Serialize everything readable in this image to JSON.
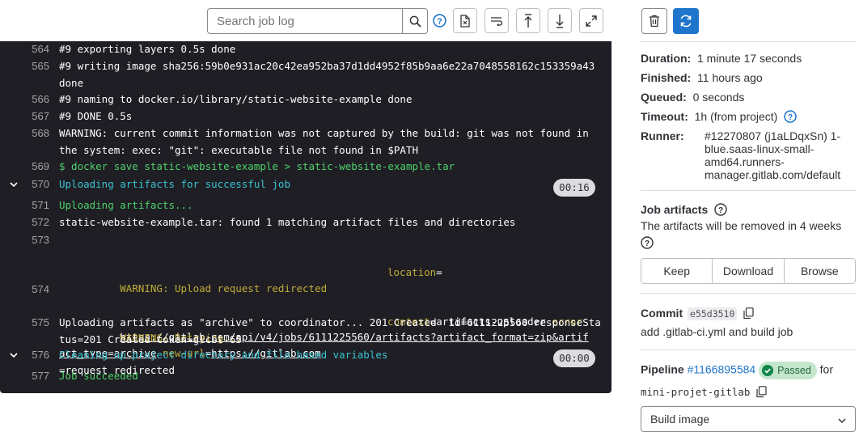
{
  "toolbar": {
    "search_placeholder": "Search job log",
    "icons": [
      "search-icon",
      "question-icon",
      "raw-file-icon",
      "wrap-text-icon",
      "scroll-top-icon",
      "scroll-bottom-icon",
      "fullscreen-icon"
    ]
  },
  "log": {
    "lines": [
      {
        "num": "564",
        "text": "#9 exporting layers 0.5s done"
      },
      {
        "num": "565",
        "text": "#9 writing image sha256:59b0e931ac20c42ea952ba37d1dd4952f85b9aa6e22a7048558162c153359a43 done"
      },
      {
        "num": "566",
        "text": "#9 naming to docker.io/library/static-website-example done"
      },
      {
        "num": "567",
        "text": "#9 DONE 0.5s"
      },
      {
        "num": "568",
        "text": "WARNING: current commit information was not captured by the build: git was not found in the system: exec: \"git\": executable file not found in $PATH"
      },
      {
        "num": "569",
        "text": "$ docker save static-website-example > static-website-example.tar"
      },
      {
        "num": "570",
        "text": "Uploading artifacts for successful job",
        "duration": "00:16"
      },
      {
        "num": "571",
        "text": "Uploading artifacts..."
      },
      {
        "num": "572",
        "text": "static-website-example.tar: found 1 matching artifact files and directories"
      },
      {
        "num": "573",
        "warn": "WARNING: Upload request redirected",
        "loc_key": "location",
        "loc_url": "https://gitlab.com/api/v4/jobs/6111225560/artifacts?artifact_format=zip&artifact_type=archive",
        "new_key": "new-url",
        "new_url": "https://gitlab.com"
      },
      {
        "num": "574",
        "warn": "WARNING: Retrying...",
        "ctx_key": "context",
        "ctx_val": "=artifacts-uploader",
        "err_key": "error",
        "err_val": "=request redirected"
      },
      {
        "num": "575",
        "text": "Uploading artifacts as \"archive\" to coordinator... 201 Created  id=6111225560 responseStatus=201 Created token=glcbt-65"
      },
      {
        "num": "576",
        "text": "Cleaning up project directory and file based variables",
        "duration": "00:00"
      },
      {
        "num": "577",
        "text": "Job succeeded"
      }
    ]
  },
  "sidebar": {
    "duration_label": "Duration:",
    "duration_value": "1 minute 17 seconds",
    "finished_label": "Finished:",
    "finished_value": "11 hours ago",
    "queued_label": "Queued:",
    "queued_value": "0 seconds",
    "timeout_label": "Timeout:",
    "timeout_value": "1h (from project)",
    "runner_label": "Runner:",
    "runner_value": "#12270807 (j1aLDqxSn) 1-blue.saas-linux-small-amd64.runners-manager.gitlab.com/default",
    "artifacts_title": "Job artifacts",
    "artifacts_text": "The artifacts will be removed in 4 weeks",
    "keep_label": "Keep",
    "download_label": "Download",
    "browse_label": "Browse",
    "commit_label": "Commit",
    "commit_sha": "e55d3510",
    "commit_message": "add .gitlab-ci.yml and build job",
    "pipeline_label": "Pipeline",
    "pipeline_id": "#1166895584",
    "pipeline_status": "Passed",
    "pipeline_for": "for",
    "project_name": "mini-projet-gitlab",
    "stage_select": "Build image",
    "colors": {
      "accent": "#1f75cb",
      "success_bg": "#c3e6cd",
      "success_text": "#24663b",
      "log_bg": "#1f1e24"
    }
  }
}
